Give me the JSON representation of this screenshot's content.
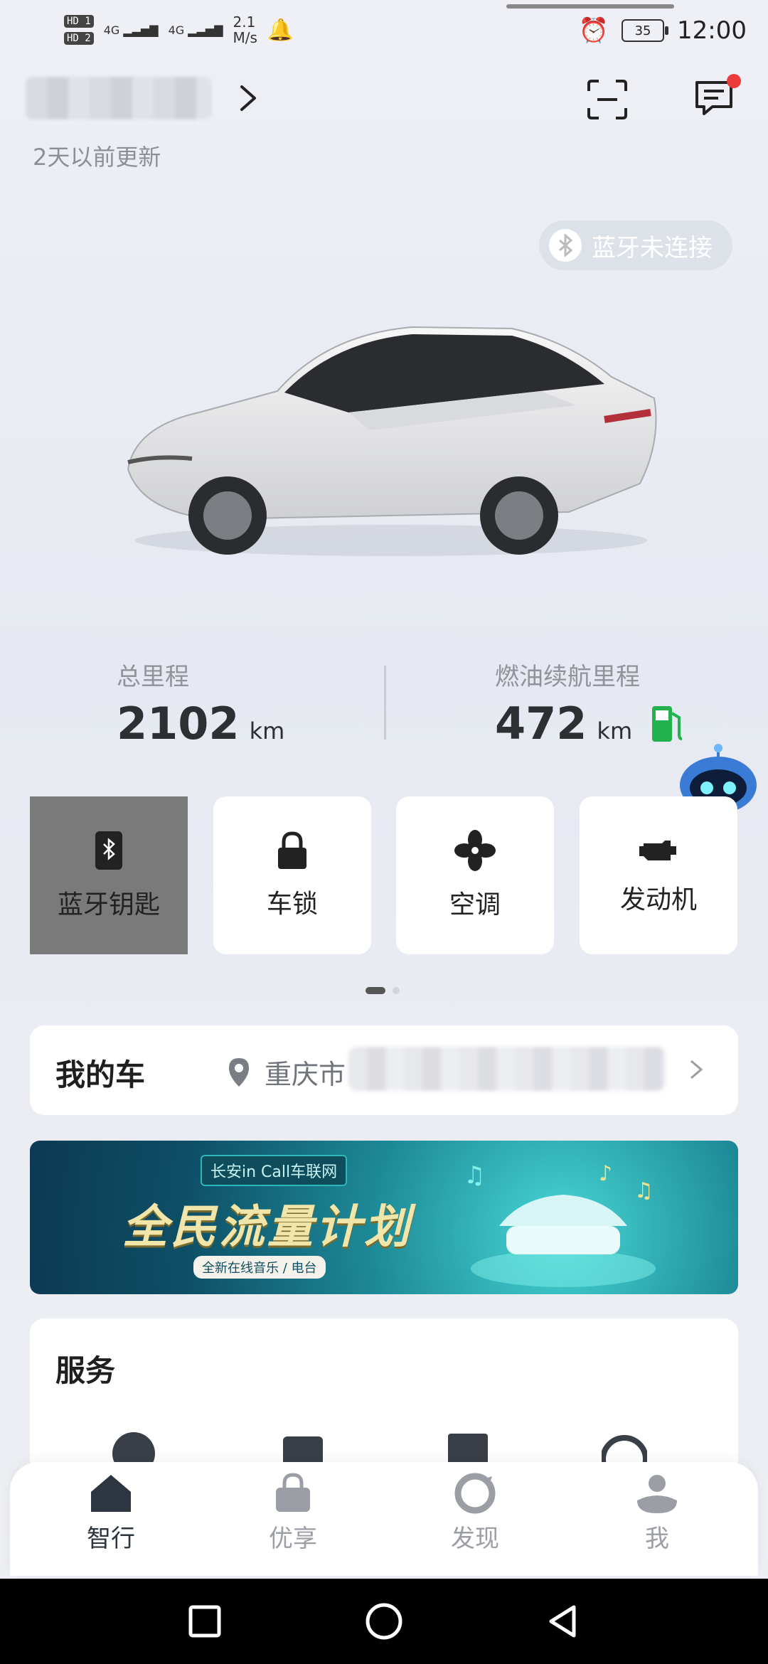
{
  "status_bar": {
    "hd1": "HD 1",
    "hd2": "HD 2",
    "signal1": "4G",
    "signal2": "4G",
    "speed_value": "2.1",
    "speed_unit": "M/s",
    "battery": "35",
    "time": "12:00"
  },
  "header": {
    "update_text": "2天以前更新"
  },
  "bluetooth_status": "蓝牙未连接",
  "stats": {
    "total_label": "总里程",
    "total_value": "2102",
    "total_unit": "km",
    "range_label": "燃油续航里程",
    "range_value": "472",
    "range_unit": "km"
  },
  "quick_controls": [
    {
      "label": "蓝牙钥匙",
      "icon": "bluetooth-key-icon"
    },
    {
      "label": "车锁",
      "icon": "lock-icon"
    },
    {
      "label": "空调",
      "icon": "fan-icon"
    },
    {
      "label": "发动机",
      "icon": "engine-icon"
    }
  ],
  "my_car": {
    "title": "我的车",
    "location": "重庆市"
  },
  "banner": {
    "tag": "长安in Call车联网",
    "title": "全民流量计划",
    "subtitle": "全新在线音乐 / 电台"
  },
  "service": {
    "title": "服务"
  },
  "bottom_nav": [
    {
      "label": "智行",
      "icon": "home-icon"
    },
    {
      "label": "优享",
      "icon": "bag-icon"
    },
    {
      "label": "发现",
      "icon": "discover-icon"
    },
    {
      "label": "我",
      "icon": "profile-icon"
    }
  ],
  "colors": {
    "accent_fuel": "#22b14c",
    "notification_dot": "#ec3b3b",
    "active_tile": "#7a7a7a"
  }
}
